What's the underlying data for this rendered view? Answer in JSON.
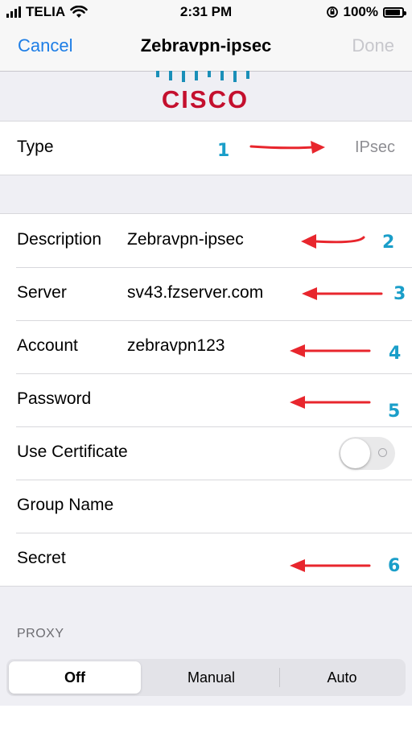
{
  "status_bar": {
    "carrier": "TELIA",
    "time": "2:31 PM",
    "battery": "100%",
    "battery_level": 1.0
  },
  "nav": {
    "cancel": "Cancel",
    "title": "Zebravpn-ipsec",
    "done": "Done"
  },
  "logo": {
    "text": "CISCO",
    "color": "#c4102e"
  },
  "type_row": {
    "label": "Type",
    "value": "IPsec"
  },
  "fields": [
    {
      "label": "Description",
      "value": "Zebravpn-ipsec"
    },
    {
      "label": "Server",
      "value": "sv43.fzserver.com"
    },
    {
      "label": "Account",
      "value": "zebravpn123"
    },
    {
      "label": "Password",
      "value": ""
    },
    {
      "label": "Use Certificate",
      "toggle": false
    },
    {
      "label": "Group Name",
      "value": ""
    },
    {
      "label": "Secret",
      "value": ""
    }
  ],
  "proxy": {
    "header": "PROXY",
    "options": [
      "Off",
      "Manual",
      "Auto"
    ],
    "selected": "Off"
  },
  "annotations": {
    "numbers": [
      "1",
      "2",
      "3",
      "4",
      "5",
      "6"
    ],
    "arrow_color": "#e8262d",
    "number_color": "#1a9ec9"
  },
  "colors": {
    "accent": "#1e7ee6",
    "disabled": "#c7c7cc",
    "secondary_text": "#8e8e93",
    "background": "#efeff4"
  }
}
